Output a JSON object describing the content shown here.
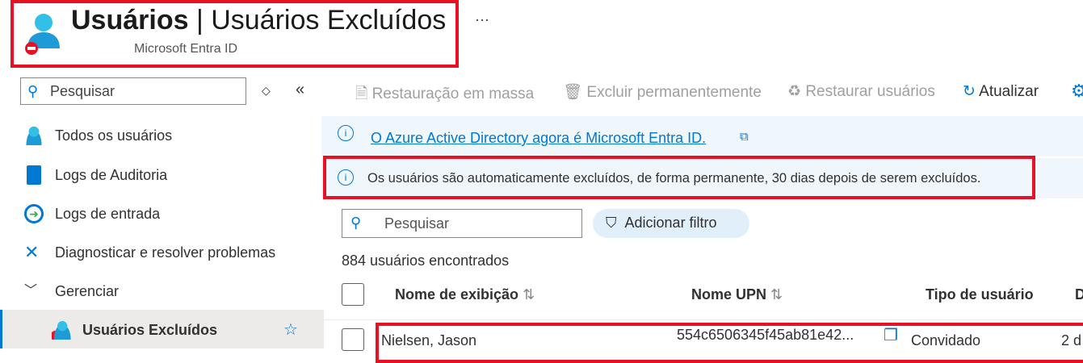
{
  "header": {
    "title_main": "Usuários",
    "title_sep": " | ",
    "title_page": "Usuários Excluídos",
    "subtitle": "Microsoft Entra ID",
    "more": "···"
  },
  "sidebar": {
    "search_placeholder": "Pesquisar",
    "items": [
      {
        "label": "Todos os usuários",
        "icon": "user-icon"
      },
      {
        "label": "Logs de Auditoria",
        "icon": "book-icon"
      },
      {
        "label": "Logs de entrada",
        "icon": "sign-in-icon"
      },
      {
        "label": "Diagnosticar e resolver problemas",
        "icon": "wrench-icon"
      },
      {
        "label": "Gerenciar",
        "icon": "chevron-down-icon"
      },
      {
        "label": "Usuários Excluídos",
        "icon": "deleted-user-icon",
        "selected": true
      }
    ]
  },
  "toolbar": {
    "bulk_restore": "Restauração em massa",
    "delete_permanently": "Excluir permanentemente",
    "restore_users": "Restaurar usuários",
    "refresh": "Atualizar"
  },
  "banners": {
    "entra": "O Azure Active Directory agora é Microsoft Entra ID.",
    "info": "Os usuários são automaticamente excluídos, de forma permanente, 30 dias depois de serem excluídos."
  },
  "list": {
    "search_placeholder": "Pesquisar",
    "add_filter": "Adicionar filtro",
    "count": "884 usuários encontrados",
    "columns": [
      "Nome de exibição",
      "Nome UPN",
      "Tipo de usuário",
      "D"
    ],
    "rows": [
      {
        "name": "Nielsen, Jason",
        "upn": "554c6506345f45ab81e42...",
        "type": "Convidado",
        "date": "2 d"
      }
    ]
  },
  "colors": {
    "accent": "#0078d4",
    "highlight": "#e81123"
  }
}
